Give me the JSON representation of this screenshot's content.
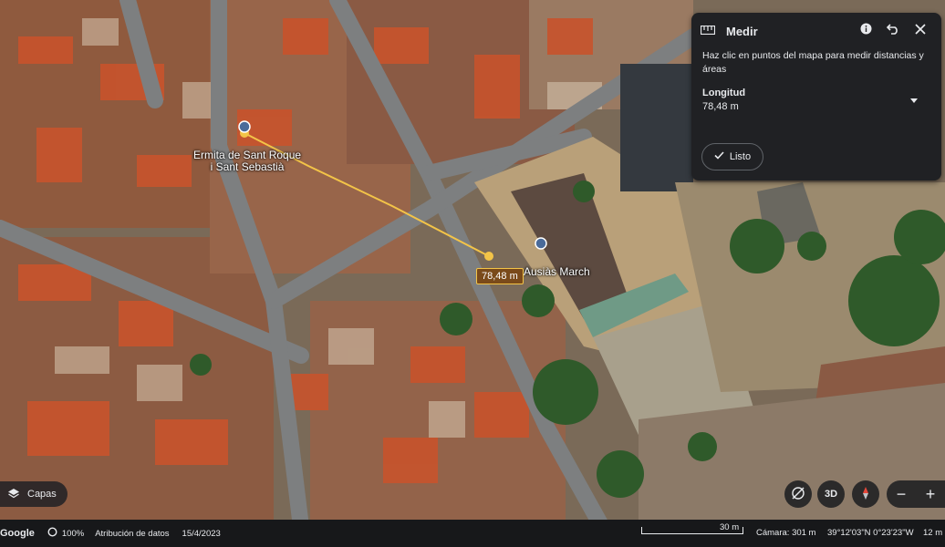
{
  "map": {
    "places": [
      {
        "name_line1": "Ermita de Sant Roque",
        "name_line2": "i Sant Sebastià"
      },
      {
        "name_line1": "Ausiàs March"
      }
    ],
    "measurement_label": "78,48 m"
  },
  "measure_panel": {
    "title": "Medir",
    "instructions": "Haz clic en puntos del mapa para medir distancias y áreas",
    "length_label": "Longitud",
    "length_value": "78,48 m",
    "done_label": "Listo",
    "icons": [
      "ruler-icon",
      "info-icon",
      "undo-icon",
      "close-icon",
      "chevron-down-icon",
      "check-icon"
    ]
  },
  "layers_button": {
    "label": "Capas",
    "icon": "layers-icon"
  },
  "controls": {
    "view_3d_label": "3D",
    "zoom_out": "−",
    "zoom_in": "+",
    "icons": [
      "tilt-icon",
      "compass-icon"
    ]
  },
  "status_bar": {
    "logo": "Google",
    "progress": "100%",
    "attribution": "Atribución de datos",
    "date": "15/4/2023",
    "scale_label": "30 m",
    "camera": "Cámara: 301 m",
    "coordinates": "39°12'03\"N 0°23'23\"W",
    "elevation": "12 m"
  },
  "colors": {
    "panel_bg": "#202124",
    "measure_line": "#f3c448",
    "measure_label_bg": "#7a4a1a"
  }
}
